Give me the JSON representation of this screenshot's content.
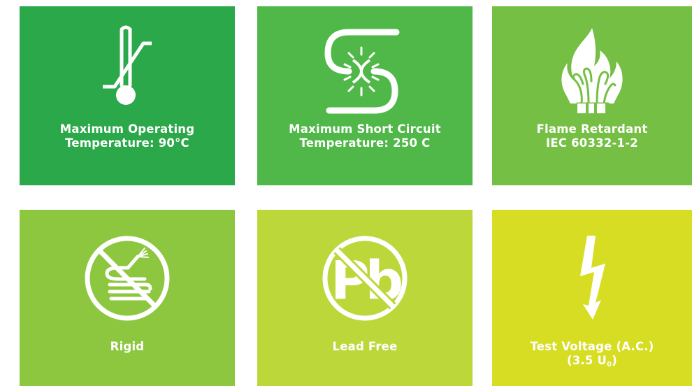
{
  "tiles": [
    {
      "id": "max-operating-temp",
      "line1": "Maximum Operating",
      "line2": "Temperature: 90°C",
      "color": "#2ba84a",
      "icon": "thermometer-icon"
    },
    {
      "id": "max-short-circuit-temp",
      "line1": "Maximum Short Circuit",
      "line2": "Temperature: 250 C",
      "color": "#4fb848",
      "icon": "short-circuit-icon"
    },
    {
      "id": "flame-retardant",
      "line1": "Flame Retardant",
      "line2": "IEC 60332-1-2",
      "color": "#74bf44",
      "icon": "flame-icon"
    },
    {
      "id": "rigid",
      "line1": "Rigid",
      "line2": "",
      "color": "#8dc63f",
      "icon": "no-coil-icon"
    },
    {
      "id": "lead-free",
      "line1": "Lead Free",
      "line2": "",
      "color": "#bcd73a",
      "icon": "no-lead-icon",
      "icon_text": "Pb"
    },
    {
      "id": "test-voltage",
      "line1": "Test Voltage (A.C.)",
      "line2_main": "(3.5 U",
      "line2_sub": "0",
      "line2_end": ")",
      "color": "#d7dd22",
      "icon": "lightning-icon"
    }
  ]
}
